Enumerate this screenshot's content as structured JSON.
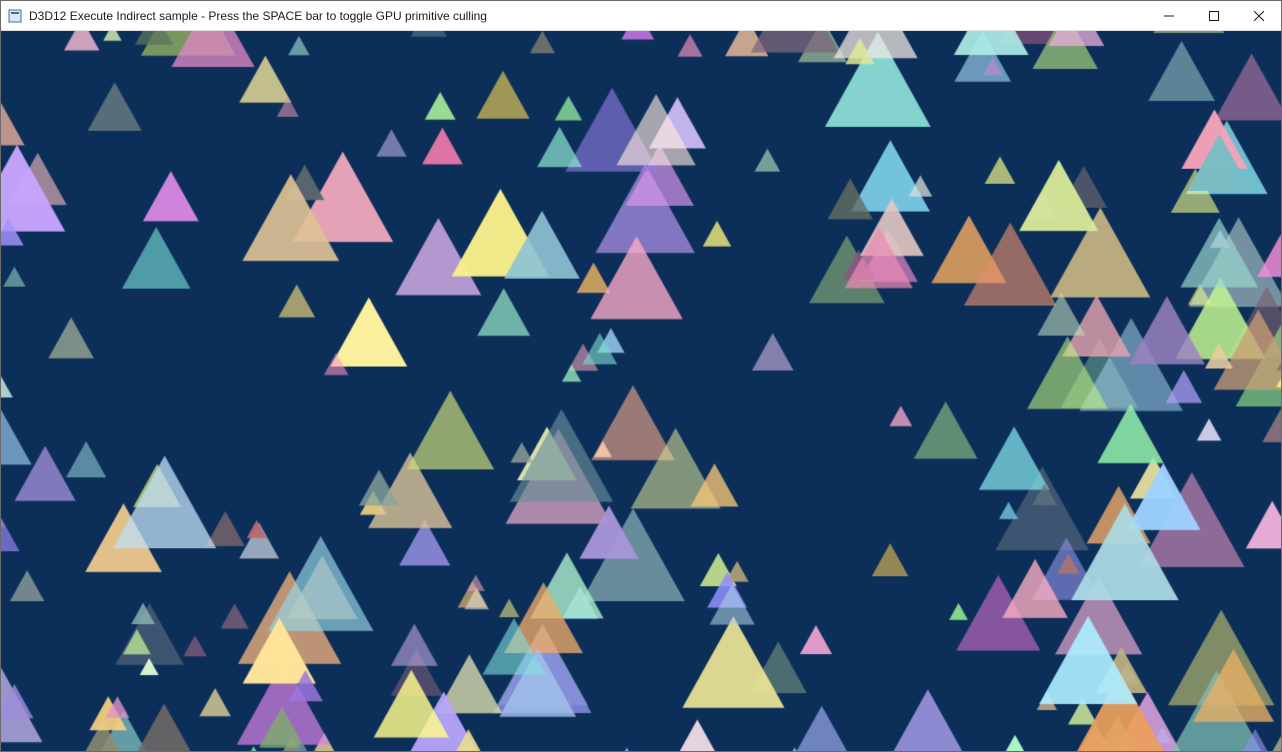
{
  "window": {
    "title": "D3D12 Execute Indirect sample - Press the SPACE bar to toggle GPU primitive culling",
    "icon_name": "app-icon"
  },
  "controls": {
    "minimize_tooltip": "Minimize",
    "maximize_tooltip": "Maximize",
    "close_tooltip": "Close"
  },
  "render": {
    "background_color": "#0c2f5a",
    "triangle_seed": 20240611,
    "triangle_count": 260,
    "triangle_min_size": 18,
    "triangle_max_size": 110,
    "palette": [
      "#a6e6a0",
      "#f7f19a",
      "#b8a2e6",
      "#f2a7c8",
      "#a7e0f2",
      "#e9a2e6",
      "#d6c98a",
      "#d0d0b0",
      "#8ab28a",
      "#6f8a9c",
      "#c2a27a",
      "#f0c688",
      "#a0c8f0",
      "#e58ab2",
      "#c4b0f2",
      "#f8f8d0",
      "#9cf2d0",
      "#d4a0a0",
      "#8a9c6f",
      "#e0b060",
      "#b0d4f2",
      "#f4e68a",
      "#d68ad6",
      "#8ad6d6",
      "#f0a07a",
      "#c0e68a",
      "#a08ad6",
      "#d6d68a",
      "#8a8ad6",
      "#e6e6e6",
      "#b07a7a",
      "#7ab0b0",
      "#f2d4a0",
      "#a0f2a0",
      "#f2a0d4",
      "#a0a0f2",
      "#d4f2a0",
      "#f2f2a0",
      "#7a607a",
      "#607a60",
      "#607a7a",
      "#7a607d"
    ]
  }
}
